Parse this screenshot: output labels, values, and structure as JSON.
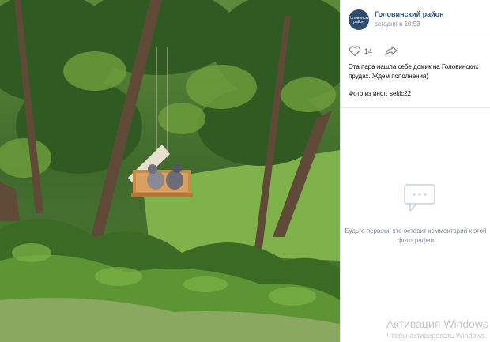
{
  "post": {
    "group_name": "Головинский район",
    "time": "сегодня в 10:53",
    "like_count": "14",
    "caption": "Эта пара нашла себе домик на Головинских прудах. Ждем пополнения)",
    "credit": "Фото из инст: seltic22",
    "avatar_text": "Головинский район"
  },
  "comments": {
    "empty_text": "Будьте первым, кто оставит комментарий к этой фотографии"
  },
  "watermark": {
    "line1": "Активация Windows",
    "line2": "Чтобы активировать Windows"
  },
  "icons": {
    "like": "heart-icon",
    "share": "share-arrow-icon",
    "empty_comments": "speech-bubble-icon"
  },
  "colors": {
    "group_link": "#2a5885",
    "secondary_text": "#818c99"
  }
}
